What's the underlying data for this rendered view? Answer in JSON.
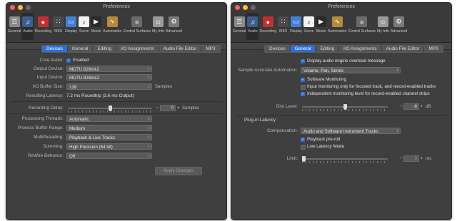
{
  "window_title": "Preferences",
  "toolbar": [
    {
      "label": "General",
      "icon": "switch-icon",
      "color": "#8a8a8a",
      "glyph": "☰"
    },
    {
      "label": "Audio",
      "icon": "audio-icon",
      "color": "#3a5f8f",
      "glyph": "♫"
    },
    {
      "label": "Recording",
      "icon": "record-icon",
      "color": "#c62d2d",
      "glyph": "●"
    },
    {
      "label": "MIDI",
      "icon": "midi-icon",
      "color": "#4a4a4a",
      "glyph": "∷"
    },
    {
      "label": "Display",
      "icon": "display-icon",
      "color": "#3f7fd8",
      "glyph": "▭"
    },
    {
      "label": "Score",
      "icon": "score-icon",
      "color": "#f2f2f2",
      "glyph": "♪"
    },
    {
      "label": "Movie",
      "icon": "movie-icon",
      "color": "#2a2a2a",
      "glyph": "▶"
    },
    {
      "label": "Automation",
      "icon": "automation-icon",
      "color": "#b58a3a",
      "glyph": "∿"
    },
    {
      "label": "Control Surfaces",
      "icon": "control-surfaces-icon",
      "color": "#6a6a6a",
      "glyph": "≡"
    },
    {
      "label": "My Info",
      "icon": "user-icon",
      "color": "#9a9a9a",
      "glyph": "☺"
    },
    {
      "label": "Advanced",
      "icon": "gear-icon",
      "color": "#7a7a7a",
      "glyph": "⚙"
    }
  ],
  "left": {
    "tabs": [
      "Devices",
      "General",
      "Editing",
      "I/O Assignments",
      "Audio File Editor",
      "MP3"
    ],
    "active_tab": "Devices",
    "core_audio": {
      "label": "Core Audio:",
      "value": "Enabled",
      "checked": true
    },
    "output_device": {
      "label": "Output Device:",
      "value": "MOTU 828mk2"
    },
    "input_device": {
      "label": "Input Device:",
      "value": "MOTU 828mk2"
    },
    "io_buffer": {
      "label": "I/O Buffer Size:",
      "value": "128",
      "unit": "Samples"
    },
    "resulting_latency": {
      "label": "Resulting Latency:",
      "value": "7.2 ms Roundtrip (3.6 ms Output)"
    },
    "recording_delay": {
      "label": "Recording Delay:",
      "value": "0",
      "unit": "Samples",
      "slider": 0.5
    },
    "processing_threads": {
      "label": "Processing Threads:",
      "value": "Automatic"
    },
    "process_buffer": {
      "label": "Process Buffer Range:",
      "value": "Medium"
    },
    "multithreading": {
      "label": "Multithreading:",
      "value": "Playback & Live Tracks"
    },
    "summing": {
      "label": "Summing:",
      "value": "High Precision (64 bit)"
    },
    "rewire": {
      "label": "ReWire Behavior:",
      "value": "Off"
    },
    "apply_button": "Apply Changes"
  },
  "right": {
    "tabs": [
      "Devices",
      "General",
      "Editing",
      "I/O Assignments",
      "Audio File Editor",
      "MP3"
    ],
    "active_tab": "General",
    "display_overload": {
      "label": "Display audio engine overload message",
      "checked": true
    },
    "sample_accurate": {
      "label": "Sample Accurate Automation:",
      "value": "Volume, Pan, Sends"
    },
    "software_monitoring": {
      "label": "Software Monitoring",
      "checked": true
    },
    "input_monitoring": {
      "label": "Input monitoring only for focused track, and record-enabled tracks",
      "checked": false
    },
    "independent_monitoring": {
      "label": "Independent monitoring level for record-enabled channel strips",
      "checked": true
    },
    "dim_level": {
      "label": "Dim Level:",
      "value": "-8",
      "unit": "dB",
      "slider": 0.5
    },
    "plugin_latency": {
      "title": "Plug-in Latency"
    },
    "compensation": {
      "label": "Compensation:",
      "value": "Audio and Software Instrument Tracks"
    },
    "playback_preroll": {
      "label": "Playback pre-roll",
      "checked": true
    },
    "low_latency": {
      "label": "Low Latency Mode",
      "checked": false
    },
    "limit": {
      "label": "Limit:",
      "value": "5",
      "unit": "ms",
      "slider": 0.02
    }
  }
}
